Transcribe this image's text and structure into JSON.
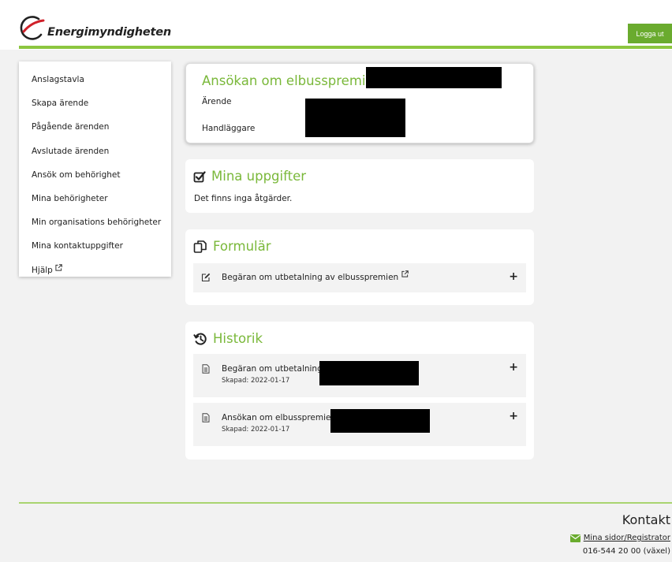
{
  "header": {
    "logo_text": "Energimyndigheten",
    "logout_label": "Logga ut"
  },
  "sidebar": {
    "items": [
      {
        "label": "Anslagstavla"
      },
      {
        "label": "Skapa ärende"
      },
      {
        "label": "Pågående ärenden"
      },
      {
        "label": "Avslutade ärenden"
      },
      {
        "label": "Ansök om behörighet"
      },
      {
        "label": "Mina behörigheter"
      },
      {
        "label": "Min organisations behörigheter"
      },
      {
        "label": "Mina kontaktuppgifter"
      },
      {
        "label": "Hjälp",
        "icon": "external-link-icon"
      }
    ]
  },
  "application": {
    "title": "Ansökan om elbusspremie",
    "case_label": "Ärende",
    "handler_label": "Handläggare"
  },
  "tasks": {
    "title": "Mina uppgifter",
    "icon": "checkbox-icon",
    "empty_text": "Det finns inga åtgärder."
  },
  "forms": {
    "title": "Formulär",
    "icon": "copy-icon",
    "items": [
      {
        "label": "Begäran om utbetalning av elbusspremien",
        "icon": "edit-icon",
        "expand": "+"
      }
    ]
  },
  "history": {
    "title": "Historik",
    "icon": "history-icon",
    "items": [
      {
        "label": "Begäran om utbetalning",
        "created": "Skapad: 2022-01-17",
        "icon": "document-icon",
        "expand": "+"
      },
      {
        "label": "Ansökan om elbusspremie",
        "created": "Skapad: 2022-01-17",
        "icon": "document-icon",
        "expand": "+"
      }
    ]
  },
  "footer": {
    "contact_title": "Kontakt",
    "contact_link": "Mina sidor/Registrator",
    "phone": "016-544 20 00 (växel)"
  },
  "colors": {
    "accent": "#7ab83a",
    "header_bar": "#8cc63f",
    "logout_bg": "#6aab2e",
    "redaction": "#000000"
  }
}
